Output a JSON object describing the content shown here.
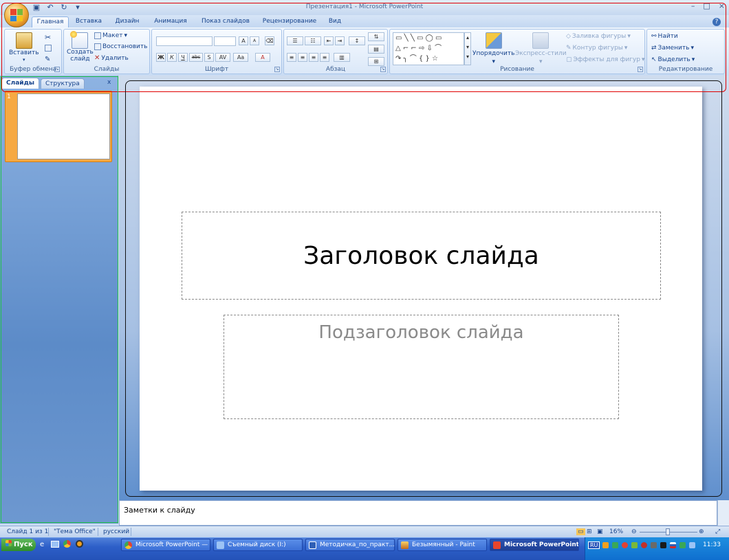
{
  "window": {
    "title": "Презентация1 - Microsoft PowerPoint",
    "controls": [
      "–",
      "□",
      "×"
    ]
  },
  "tabs": [
    "Главная",
    "Вставка",
    "Дизайн",
    "Анимация",
    "Показ слайдов",
    "Рецензирование",
    "Вид"
  ],
  "ribbon": {
    "clipboard": {
      "paste": "Вставить",
      "label": "Буфер обмена"
    },
    "slides": {
      "new_slide_line1": "Создать",
      "new_slide_line2": "слайд",
      "layout": "Макет",
      "reset": "Восстановить",
      "delete": "Удалить",
      "label": "Слайды"
    },
    "font": {
      "label": "Шрифт",
      "bold": "Ж",
      "italic": "К",
      "underline": "Ч",
      "strike": "abc",
      "shadow": "S",
      "spacing": "AV",
      "case": "Aa",
      "color": "A",
      "grow": "A",
      "shrink": "A"
    },
    "paragraph": {
      "label": "Абзац"
    },
    "drawing": {
      "arrange": "Упорядочить",
      "quick_styles": "Экспресс-стили",
      "fill": "Заливка фигуры",
      "outline": "Контур фигуры",
      "effects": "Эффекты для фигур",
      "label": "Рисование"
    },
    "editing": {
      "find": "Найти",
      "replace": "Заменить",
      "select": "Выделить",
      "label": "Редактирование"
    }
  },
  "left_pane": {
    "tabs": [
      "Слайды",
      "Структура"
    ],
    "close": "x",
    "slide_number": "1"
  },
  "slide": {
    "title": "Заголовок слайда",
    "subtitle": "Подзаголовок слайда"
  },
  "notes": {
    "placeholder": "Заметки к слайду"
  },
  "statusbar": {
    "slide_count": "Слайд 1 из 1",
    "theme": "\"Тема Office\"",
    "language": "русский",
    "zoom": "16%"
  },
  "taskbar": {
    "start": "Пуск",
    "buttons": [
      {
        "label": "Microsoft PowerPoint — ..."
      },
      {
        "label": "Съемный диск (I:)"
      },
      {
        "label": "Методичка_по_практ..."
      },
      {
        "label": "Безымянный - Paint"
      },
      {
        "label": "Microsoft PowerPoint ..."
      }
    ],
    "clock": "11:33",
    "lang": "RU"
  },
  "colors": {
    "accent": "#15428b",
    "ribbon_outline": "#e00000",
    "pane_outline": "#22c24a",
    "thumb_highlight": "#f6a942"
  }
}
